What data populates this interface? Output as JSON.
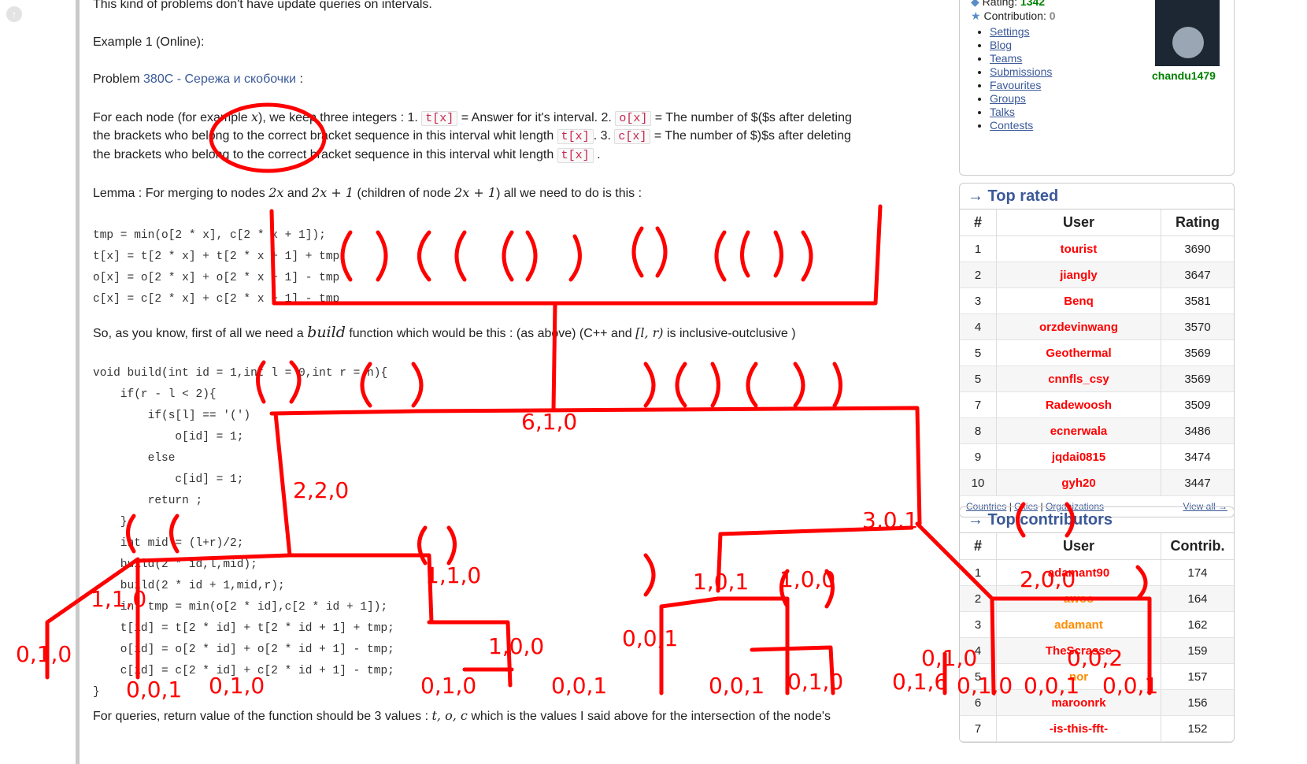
{
  "article": {
    "line_top": "This kind of problems don't have update queries on intervals.",
    "example_title": "Example 1 (Online):",
    "problem_prefix": "Problem",
    "problem_link": "380C - Сережа и скобочки",
    "problem_suffix": ":",
    "each_node_1": "For each node (for example",
    "each_node_x": "x",
    "each_node_2": "), we keep three integers : 1.",
    "t_tag": "t[x]",
    "each_node_3": "= Answer for it's interval. 2.",
    "o_tag": "o[x]",
    "each_node_4": "= The number of $($s after deleting",
    "line2_a": "the brackets who belong to the correct bracket sequence in this interval whit length",
    "line2_b": ". 3.",
    "c_tag": "c[x]",
    "line2_c": "= The number of $)$s after deleting",
    "line3_a": "the brackets who belong to the correct bracket sequence in this interval whit length",
    "line3_b": ".",
    "lemma_a": "Lemma : For merging to nodes",
    "lemma_2x": "2x",
    "lemma_and": "and",
    "lemma_2x1": "2x + 1",
    "lemma_b": "(children of node",
    "lemma_c": ") all we need to do is this :",
    "code1": [
      "tmp = min(o[2 * x], c[2 * x + 1]);",
      "t[x] = t[2 * x] + t[2 * x + 1] + tmp",
      "o[x] = o[2 * x] + o[2 * x + 1] - tmp",
      "c[x] = c[2 * x] + c[2 * x + 1] - tmp"
    ],
    "so_a": "So, as you know, first of all we need a",
    "so_build": "build",
    "so_b": "function which would be this : (as above) (C++ and",
    "so_lr": "[l, r)",
    "so_c": "is inclusive-outclusive )",
    "code2": [
      "void build(int id = 1,int l = 0,int r = n){",
      "    if(r - l < 2){",
      "        if(s[l] == '(')",
      "            o[id] = 1;",
      "        else",
      "            c[id] = 1;",
      "        return ;",
      "    }",
      "    int mid = (l+r)/2;",
      "    build(2 * id,l,mid);",
      "    build(2 * id + 1,mid,r);",
      "    int tmp = min(o[2 * id],c[2 * id + 1]);",
      "    t[id] = t[2 * id] + t[2 * id + 1] + tmp;",
      "    o[id] = o[2 * id] + o[2 * id + 1] - tmp;",
      "    c[id] = c[2 * id] + c[2 * id + 1] - tmp;",
      "}"
    ],
    "queries_a": "For queries, return value of the function should be 3 values :",
    "queries_vars": "t, o, c",
    "queries_b": "which is the values I said above for the intersection of the node's"
  },
  "sidebar": {
    "rating_label": "Rating:",
    "rating_value": "1342",
    "contribution_label": "Contribution:",
    "contribution_value": "0",
    "links": [
      "Settings",
      "Blog",
      "Teams",
      "Submissions",
      "Favourites",
      "Groups",
      "Talks",
      "Contests"
    ],
    "username": "chandu1479",
    "top_rated": {
      "title": "→ Top rated",
      "headers": [
        "#",
        "User",
        "Rating"
      ],
      "rows": [
        [
          "1",
          "tourist",
          "3690"
        ],
        [
          "2",
          "jiangly",
          "3647"
        ],
        [
          "3",
          "Benq",
          "3581"
        ],
        [
          "4",
          "orzdevinwang",
          "3570"
        ],
        [
          "5",
          "Geothermal",
          "3569"
        ],
        [
          "5",
          "cnnfls_csy",
          "3569"
        ],
        [
          "7",
          "Radewoosh",
          "3509"
        ],
        [
          "8",
          "ecnerwala",
          "3486"
        ],
        [
          "9",
          "jqdai0815",
          "3474"
        ],
        [
          "10",
          "gyh20",
          "3447"
        ]
      ],
      "footer_links": [
        "Countries",
        "Cities",
        "Organizations"
      ],
      "view_all": "View all →"
    },
    "top_contributors": {
      "title": "→ Top contributors",
      "headers": [
        "#",
        "User",
        "Contrib."
      ],
      "rows": [
        [
          "1",
          "adamant90",
          "174"
        ],
        [
          "2",
          "awoo",
          "164"
        ],
        [
          "3",
          "adamant",
          "162"
        ],
        [
          "4",
          "TheScrasse",
          "159"
        ],
        [
          "5",
          "nor",
          "157"
        ],
        [
          "6",
          "maroonrk",
          "156"
        ],
        [
          "7",
          "-is-this-fft-",
          "152"
        ]
      ]
    }
  },
  "annotations": {
    "labels": [
      "6,1,0",
      "2,2,0",
      "3,0,1",
      "1,1,0",
      "1,0,1",
      "1,0,0",
      "1,0,0",
      "0,1,0",
      "1,1,0",
      "0,0,1",
      "0,0,1",
      "0,1,6",
      "0,1,0",
      "0,0,1",
      "0,1,0",
      "0,0,1",
      "0,1,0",
      "0,1,0",
      "0,0,1",
      "0,0,1",
      "2,0,0",
      "0,1,0",
      "0,0,2"
    ],
    "color": "#ff0000"
  }
}
